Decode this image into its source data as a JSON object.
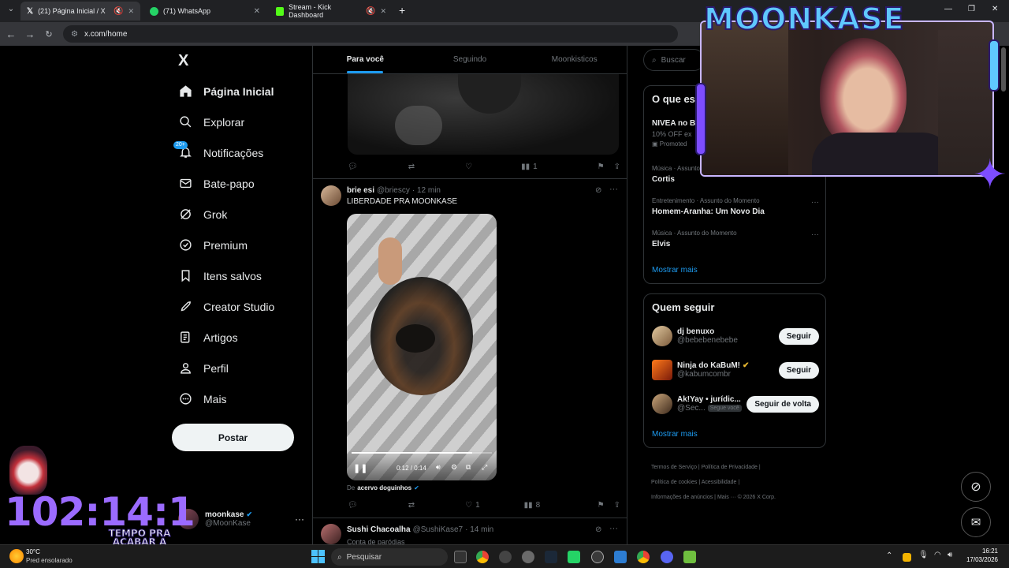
{
  "browser": {
    "tabs": [
      {
        "title": "(21) Página Inicial / X"
      },
      {
        "title": "(71) WhatsApp"
      },
      {
        "title": "Stream - Kick Dashboard"
      }
    ],
    "url": "x.com/home",
    "new_tab": "+"
  },
  "x": {
    "logo": "X",
    "nav": [
      {
        "label": "Página Inicial",
        "icon": "home-icon"
      },
      {
        "label": "Explorar",
        "icon": "search-icon"
      },
      {
        "label": "Notificações",
        "icon": "bell-icon",
        "badge": "20+"
      },
      {
        "label": "Bate-papo",
        "icon": "mail-icon"
      },
      {
        "label": "Grok",
        "icon": "grok-icon"
      },
      {
        "label": "Premium",
        "icon": "verified-icon"
      },
      {
        "label": "Itens salvos",
        "icon": "bookmark-icon"
      },
      {
        "label": "Creator Studio",
        "icon": "rocket-icon"
      },
      {
        "label": "Artigos",
        "icon": "article-icon"
      },
      {
        "label": "Perfil",
        "icon": "person-icon"
      },
      {
        "label": "Mais",
        "icon": "more-circle-icon"
      }
    ],
    "post_button": "Postar",
    "account": {
      "name": "moonkase",
      "handle": "@MoonKase"
    },
    "feed_tabs": [
      "Para você",
      "Seguindo",
      "Moonkisticos"
    ],
    "post1": {
      "views": "1"
    },
    "post2": {
      "name": "brie esi",
      "handle": "@briescy",
      "time": "· 12 min",
      "text": "LIBERDADE PRA MOONKASE",
      "video_time": "0:12 / 0:14",
      "video_progress": 0.857,
      "from_prefix": "De",
      "from_account": "acervo doguinhos",
      "likes": "1",
      "views": "8"
    },
    "post3": {
      "name": "Sushi Chacoalha",
      "handle": "@SushiKase7",
      "time": "· 14 min",
      "subtext": "Conta de paródias"
    },
    "search_placeholder": "Buscar",
    "trends_title": "O que es",
    "promo": {
      "title": "NIVEA no B",
      "sub": "10% OFF ex",
      "label": "Promoted"
    },
    "trends": [
      {
        "meta": "Música · Assunto",
        "title": "Cortis"
      },
      {
        "meta": "Entretenimento · Assunto do Momento",
        "title": "Homem-Aranha: Um Novo Dia"
      },
      {
        "meta": "Música · Assunto do Momento",
        "title": "Elvis"
      }
    ],
    "show_more": "Mostrar mais",
    "who_to_follow": "Quem seguir",
    "suggestions": [
      {
        "name": "dj benuxo",
        "handle": "@bebebenebebe",
        "button": "Seguir"
      },
      {
        "name": "Ninja do KaBuM!",
        "handle": "@kabumcombr",
        "button": "Seguir"
      },
      {
        "name": "Ak!Yay • jurídic...",
        "handle": "@Sec...",
        "follows_you": "Segue você",
        "button": "Seguir de volta"
      }
    ],
    "show_more2": "Mostrar mais",
    "footer": [
      "Termos de Serviço",
      "Política de Privacidade",
      "Política de cookies",
      "Acessibilidade",
      "Informações de anúncios",
      "Mais ···",
      "© 2026 X Corp."
    ]
  },
  "overlay": {
    "logo": "MOONKASE",
    "timer": "102:14:1",
    "caption": "TEMPO PRA ACABAR A TORTURA"
  },
  "taskbar": {
    "weather_temp": "30°C",
    "weather_desc": "Pred ensolarado",
    "search": "Pesquisar",
    "time": "16:21",
    "date": "17/03/2026"
  }
}
